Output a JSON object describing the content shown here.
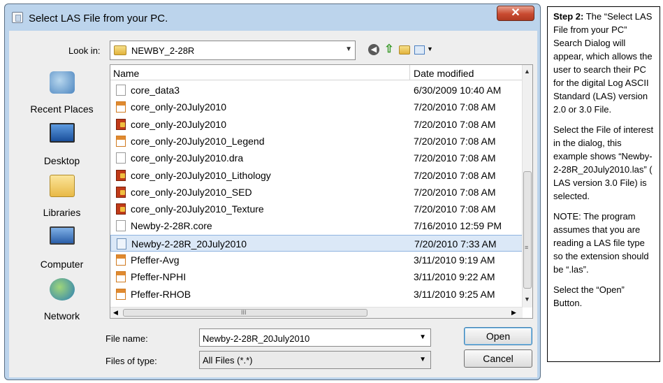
{
  "window": {
    "title": "Select LAS File from your PC.",
    "close_glyph": "✕"
  },
  "lookin": {
    "label": "Look in:",
    "value": "NEWBY_2-28R"
  },
  "places": [
    {
      "label": "Recent Places",
      "icon": "recent-places-icon"
    },
    {
      "label": "Desktop",
      "icon": "desktop-icon"
    },
    {
      "label": "Libraries",
      "icon": "libraries-icon"
    },
    {
      "label": "Computer",
      "icon": "computer-icon"
    },
    {
      "label": "Network",
      "icon": "network-icon"
    }
  ],
  "columns": {
    "name": "Name",
    "date": "Date modified"
  },
  "files": [
    {
      "name": "core_data3",
      "date": "6/30/2009 10:40 AM",
      "type": "doc"
    },
    {
      "name": "core_only-20July2010",
      "date": "7/20/2010 7:08 AM",
      "type": "pdf"
    },
    {
      "name": "core_only-20July2010",
      "date": "7/20/2010 7:08 AM",
      "type": "img"
    },
    {
      "name": "core_only-20July2010_Legend",
      "date": "7/20/2010 7:08 AM",
      "type": "pdf"
    },
    {
      "name": "core_only-20July2010.dra",
      "date": "7/20/2010 7:08 AM",
      "type": "doc"
    },
    {
      "name": "core_only-20July2010_Lithology",
      "date": "7/20/2010 7:08 AM",
      "type": "img"
    },
    {
      "name": "core_only-20July2010_SED",
      "date": "7/20/2010 7:08 AM",
      "type": "img"
    },
    {
      "name": "core_only-20July2010_Texture",
      "date": "7/20/2010 7:08 AM",
      "type": "img"
    },
    {
      "name": "Newby-2-28R.core",
      "date": "7/16/2010 12:59 PM",
      "type": "doc"
    },
    {
      "name": "Newby-2-28R_20July2010",
      "date": "7/20/2010 7:33 AM",
      "type": "las",
      "selected": true
    },
    {
      "name": "Pfeffer-Avg",
      "date": "3/11/2010 9:19 AM",
      "type": "pdf"
    },
    {
      "name": "Pfeffer-NPHI",
      "date": "3/11/2010 9:22 AM",
      "type": "pdf"
    },
    {
      "name": "Pfeffer-RHOB",
      "date": "3/11/2010 9:25 AM",
      "type": "pdf"
    }
  ],
  "scroll": {
    "grip": "≡",
    "hgrip": "III"
  },
  "filename": {
    "label": "File name:",
    "value": "Newby-2-28R_20July2010"
  },
  "filetype": {
    "label": "Files of type:",
    "value": "All Files (*.*)"
  },
  "buttons": {
    "open": "Open",
    "cancel": "Cancel"
  },
  "note": {
    "step_label": "Step 2:",
    "p1": " The “Select LAS File from your PC” Search Dialog will appear, which allows the user to search their PC for the digital Log ASCII Standard (LAS) version 2.0 or 3.0 File.",
    "p2": "Select the File of interest in the dialog, this example shows “Newby-2-28R_20July2010.las” ( LAS version 3.0 File) is selected.",
    "p3": "NOTE: The program assumes that you are reading a LAS file type so the extension should be “.las”.",
    "p4": "Select the “Open” Button."
  }
}
